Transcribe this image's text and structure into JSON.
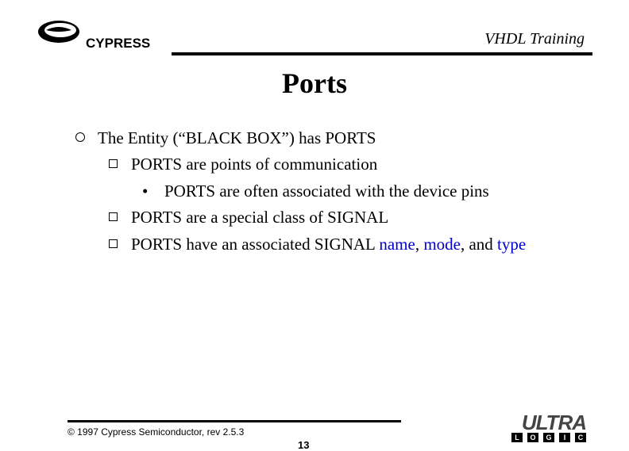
{
  "header": {
    "logo_company": "CYPRESS",
    "course_title": "VHDL Training"
  },
  "slide": {
    "title": "Ports"
  },
  "bullets": {
    "main": "The Entity (“BLACK BOX”) has PORTS",
    "sub1": "PORTS are points of communication",
    "sub1a": "PORTS are often associated with the device pins",
    "sub2": "PORTS are a special class of SIGNAL",
    "sub3_prefix": "PORTS have an associated SIGNAL ",
    "sub3_name": "name",
    "sub3_comma": ", ",
    "sub3_mode": "mode",
    "sub3_and": ", and ",
    "sub3_type": "type"
  },
  "footer": {
    "copyright": "© 1997 Cypress Semiconductor, rev 2.5.3",
    "page": "13",
    "brand": "ULTRA",
    "logic_letters": [
      "L",
      "O",
      "G",
      "I",
      "C"
    ]
  }
}
